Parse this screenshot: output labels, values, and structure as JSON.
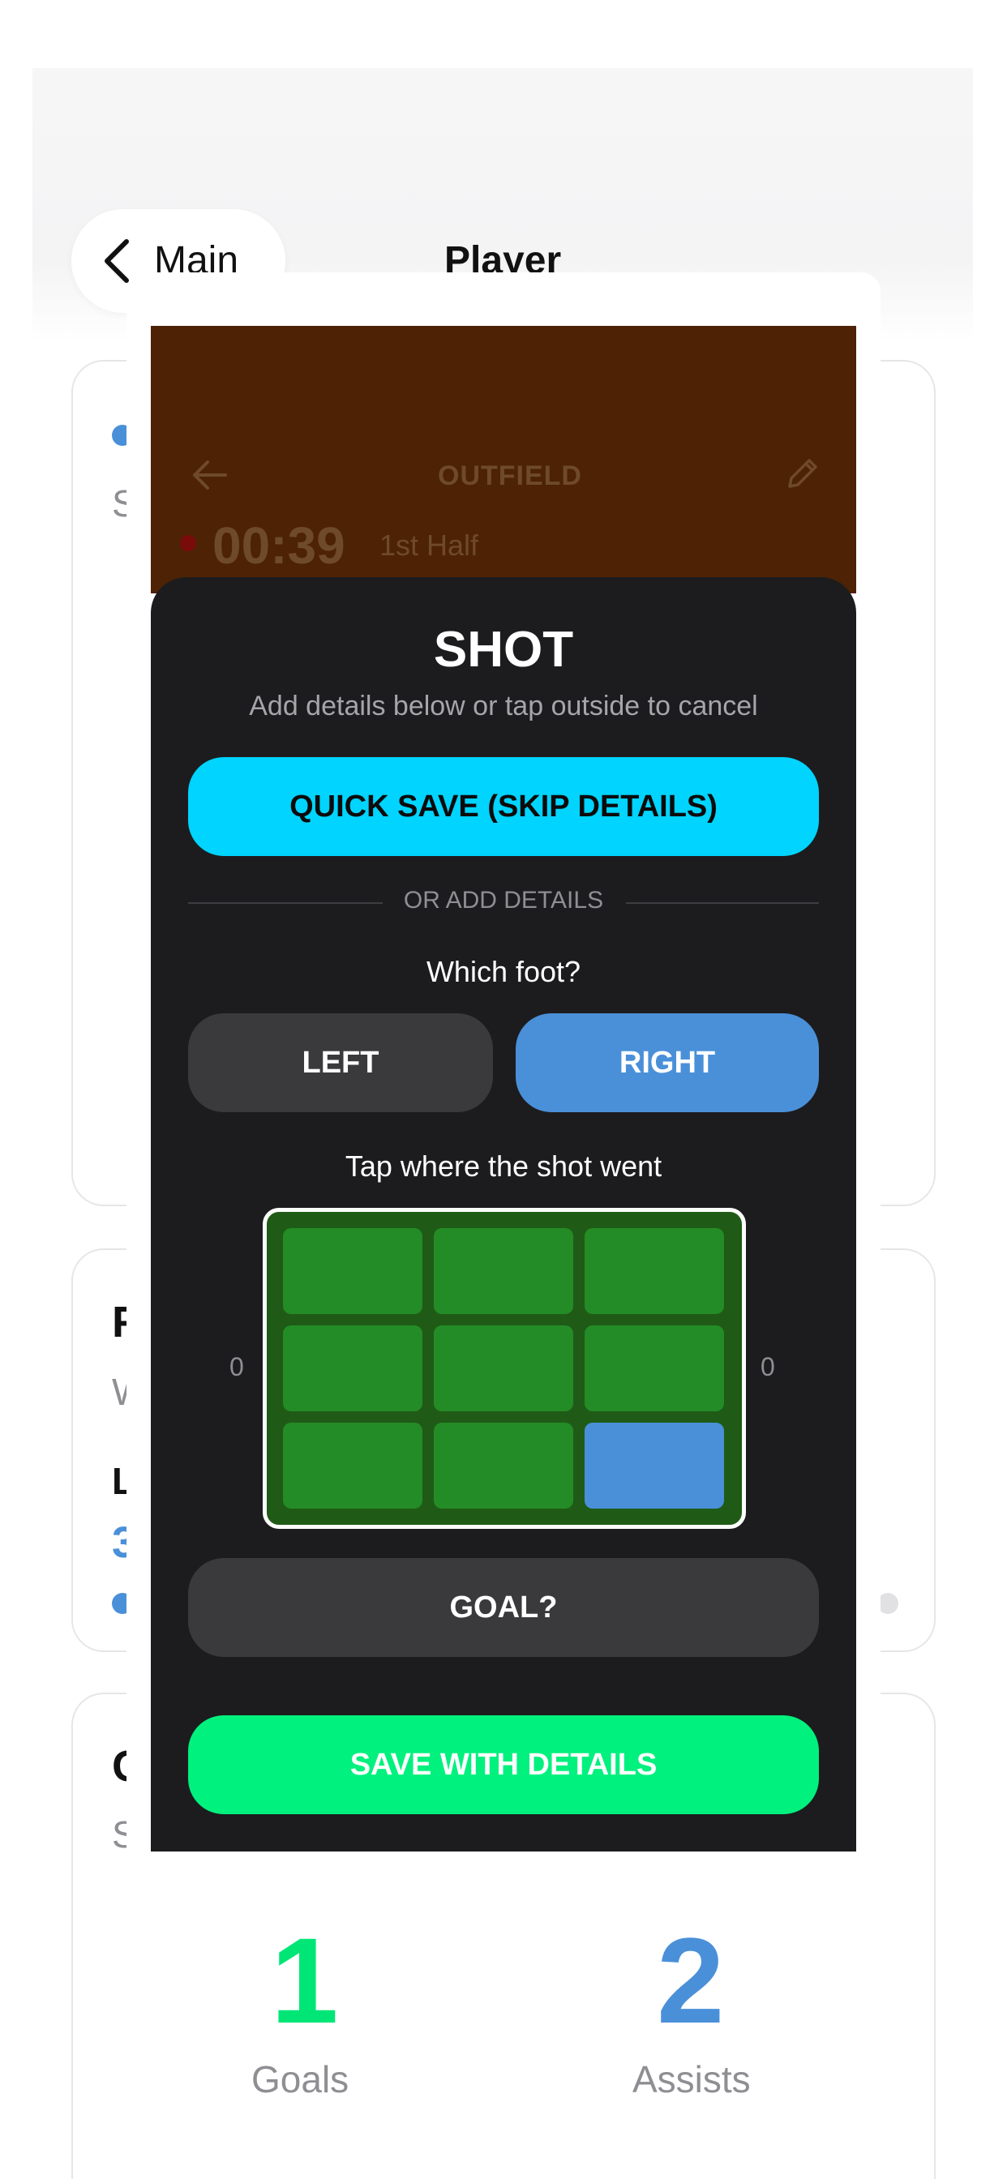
{
  "nav": {
    "back_label": "Main",
    "title": "Player"
  },
  "background": {
    "card1_peek_text": "S",
    "card2_peek_title": "F",
    "card2_peek_text": "W",
    "card2_peek_label": "L",
    "card2_peek_value": "3",
    "card3_peek_title": "C",
    "card3_peek_text": "S",
    "stats": [
      {
        "value": "1",
        "label": "Goals",
        "color": "#00e676"
      },
      {
        "value": "2",
        "label": "Assists",
        "color": "#4a90d9"
      }
    ]
  },
  "live": {
    "title": "OUTFIELD",
    "clock": "00:39",
    "period": "1st Half",
    "header_color": "#4d2205"
  },
  "sheet": {
    "title": "SHOT",
    "subtitle": "Add details below or tap outside to cancel",
    "quick_save": "QUICK SAVE (SKIP DETAILS)",
    "divider": "OR ADD DETAILS",
    "foot_question": "Which foot?",
    "foot_left": "LEFT",
    "foot_right": "RIGHT",
    "foot_selected": "RIGHT",
    "target_prompt": "Tap where the shot went",
    "left_count": "0",
    "right_count": "0",
    "selected_zone": 8,
    "goal_toggle": "GOAL?",
    "save_details": "SAVE WITH DETAILS"
  },
  "colors": {
    "accent_cyan": "#00d4ff",
    "accent_green": "#00f17e",
    "accent_blue": "#4a90d9",
    "zone_green": "#248c26",
    "sheet_bg": "#1c1c1e"
  }
}
